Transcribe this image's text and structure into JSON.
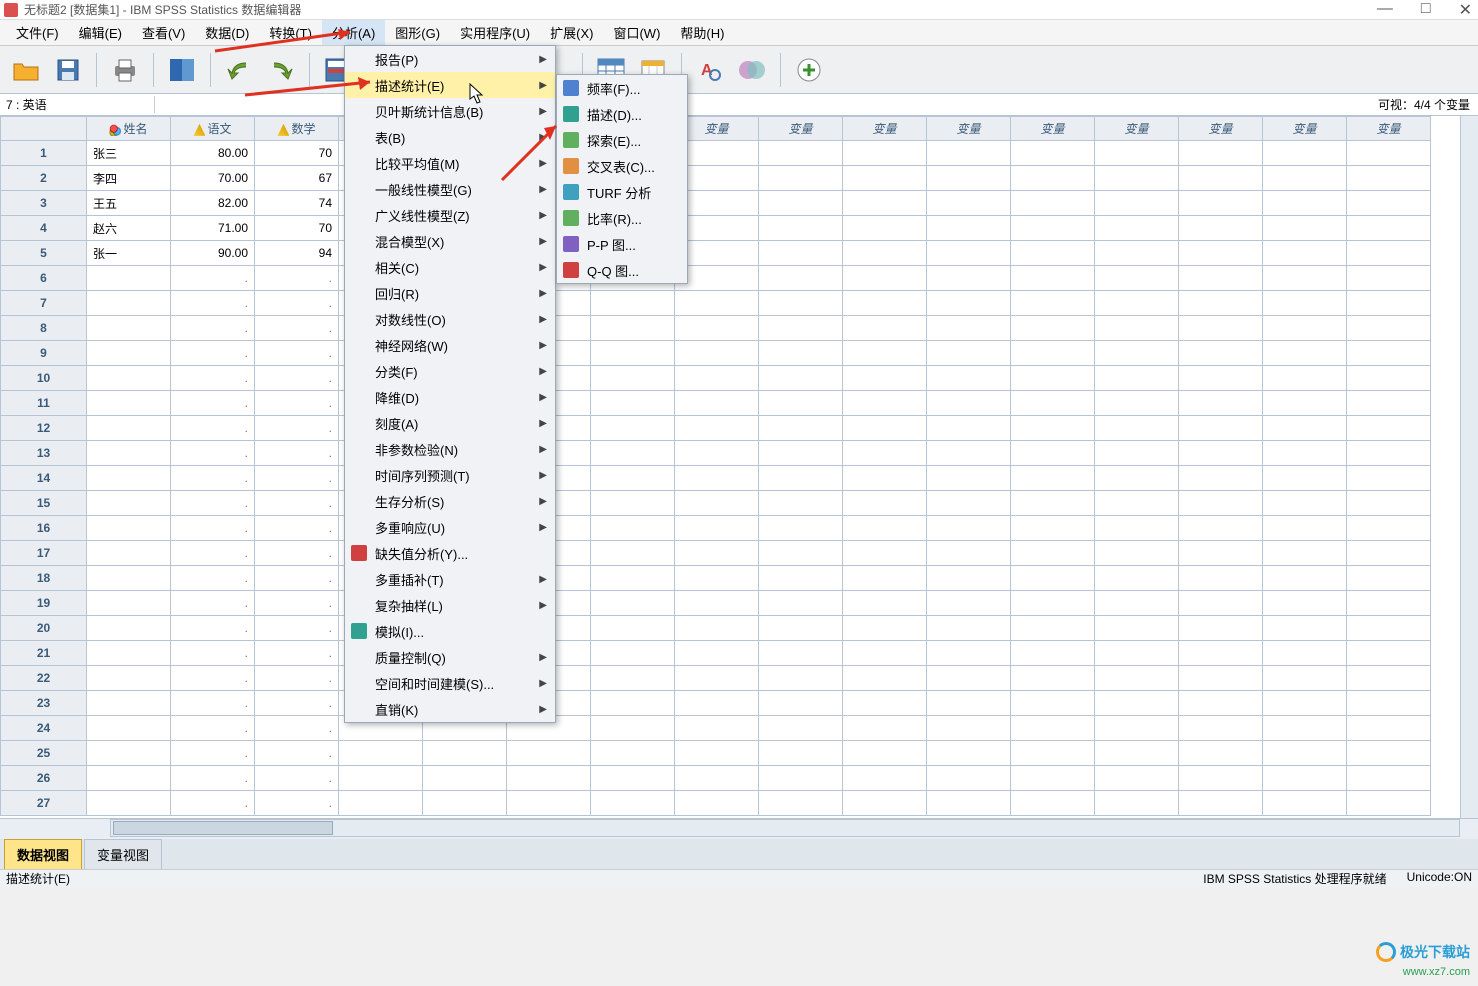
{
  "title": "无标题2 [数据集1] - IBM SPSS Statistics 数据编辑器",
  "menu_bar": [
    "文件(F)",
    "编辑(E)",
    "查看(V)",
    "数据(D)",
    "转换(T)",
    "分析(A)",
    "图形(G)",
    "实用程序(U)",
    "扩展(X)",
    "窗口(W)",
    "帮助(H)"
  ],
  "active_menu_index": 5,
  "cell_ref": "7 : 英语",
  "cell_val": "",
  "visible_info": "可视：4/4 个变量",
  "columns_named": [
    {
      "label": "姓名",
      "type": "nominal"
    },
    {
      "label": "语文",
      "type": "scale"
    },
    {
      "label": "数学",
      "type": "scale"
    }
  ],
  "generic_var": "变量",
  "data_rows": [
    {
      "n": 1,
      "name": "张三",
      "v1": "80.00",
      "v2": "70"
    },
    {
      "n": 2,
      "name": "李四",
      "v1": "70.00",
      "v2": "67"
    },
    {
      "n": 3,
      "name": "王五",
      "v1": "82.00",
      "v2": "74"
    },
    {
      "n": 4,
      "name": "赵六",
      "v1": "71.00",
      "v2": "70"
    },
    {
      "n": 5,
      "name": "张一",
      "v1": "90.00",
      "v2": "94"
    }
  ],
  "empty_placeholder": ".",
  "menu1_items": [
    {
      "label": "报告(P)",
      "arrow": true
    },
    {
      "label": "描述统计(E)",
      "arrow": true,
      "highlighted": true
    },
    {
      "label": "贝叶斯统计信息(B)",
      "arrow": true
    },
    {
      "label": "表(B)",
      "arrow": true
    },
    {
      "label": "比较平均值(M)",
      "arrow": true
    },
    {
      "label": "一般线性模型(G)",
      "arrow": true
    },
    {
      "label": "广义线性模型(Z)",
      "arrow": true
    },
    {
      "label": "混合模型(X)",
      "arrow": true
    },
    {
      "label": "相关(C)",
      "arrow": true
    },
    {
      "label": "回归(R)",
      "arrow": true
    },
    {
      "label": "对数线性(O)",
      "arrow": true
    },
    {
      "label": "神经网络(W)",
      "arrow": true
    },
    {
      "label": "分类(F)",
      "arrow": true
    },
    {
      "label": "降维(D)",
      "arrow": true
    },
    {
      "label": "刻度(A)",
      "arrow": true
    },
    {
      "label": "非参数检验(N)",
      "arrow": true
    },
    {
      "label": "时间序列预测(T)",
      "arrow": true
    },
    {
      "label": "生存分析(S)",
      "arrow": true
    },
    {
      "label": "多重响应(U)",
      "arrow": true
    },
    {
      "label": "缺失值分析(Y)...",
      "arrow": false,
      "icon": "mi-red"
    },
    {
      "label": "多重插补(T)",
      "arrow": true
    },
    {
      "label": "复杂抽样(L)",
      "arrow": true
    },
    {
      "label": "模拟(I)...",
      "arrow": false,
      "icon": "mi-teal"
    },
    {
      "label": "质量控制(Q)",
      "arrow": true
    },
    {
      "label": "空间和时间建模(S)...",
      "arrow": true
    },
    {
      "label": "直销(K)",
      "arrow": true
    }
  ],
  "menu2_items": [
    {
      "label": "频率(F)...",
      "icon": "mi-blue"
    },
    {
      "label": "描述(D)...",
      "icon": "mi-teal"
    },
    {
      "label": "探索(E)...",
      "icon": "mi-green"
    },
    {
      "label": "交叉表(C)...",
      "icon": "mi-orange"
    },
    {
      "label": "TURF 分析",
      "icon": "mi-cyan"
    },
    {
      "label": "比率(R)...",
      "icon": "mi-green"
    },
    {
      "label": "P-P 图...",
      "icon": "mi-purple"
    },
    {
      "label": "Q-Q 图...",
      "icon": "mi-red"
    }
  ],
  "tabs": {
    "data": "数据视图",
    "variable": "变量视图"
  },
  "status_left": "描述统计(E)",
  "status_center": "IBM SPSS Statistics 处理程序就绪",
  "status_right": "Unicode:ON",
  "watermark_text": "极光下载站",
  "watermark_url": "www.xz7.com"
}
